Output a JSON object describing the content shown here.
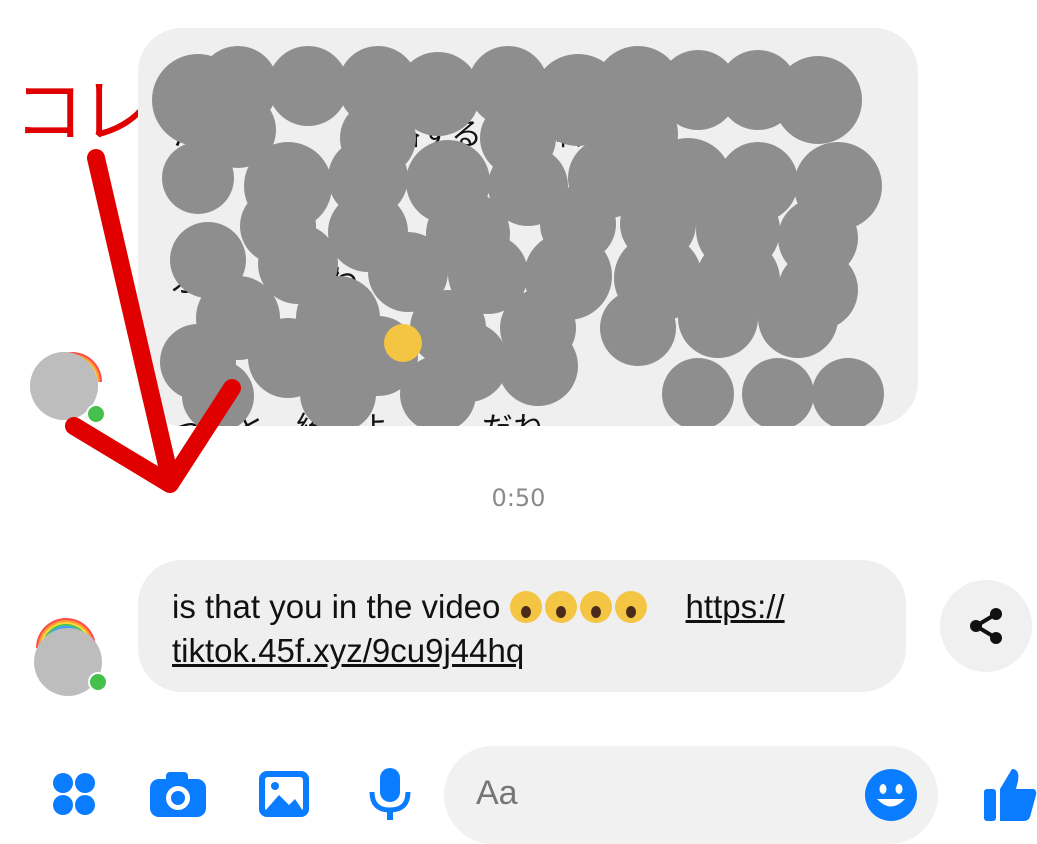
{
  "annotation": {
    "label": "コレ",
    "color": "#e00000"
  },
  "message1": {
    "lines": [
      "あ　　　　　　　　　　　　　　っ",
      "た　ち　　　　略すると　体人数決",
      "",
      "",
      "ぷ　　　　わ　　　　の　だ",
      "",
      "",
      "っ　と　統　よ　　　だね。"
    ],
    "emoji_names": [
      "grinning-sweat-emoji"
    ]
  },
  "timestamp": "0:50",
  "message2": {
    "text": "is that you in the video ",
    "emoji_names": [
      "screaming-emoji",
      "screaming-emoji",
      "screaming-emoji",
      "screaming-emoji"
    ],
    "link_line1": "https://",
    "link_line2": "tiktok.45f.xyz/9cu9j44hq"
  },
  "toolbar": {
    "icons": [
      "menu-dots-icon",
      "camera-icon",
      "image-icon",
      "microphone-icon",
      "emoji-icon",
      "thumbs-up-icon"
    ],
    "compose_placeholder": "Aa",
    "accent": "#0a7cff"
  }
}
